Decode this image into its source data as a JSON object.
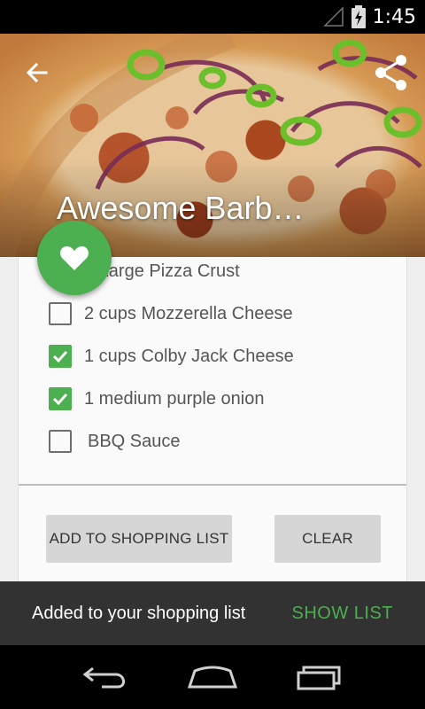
{
  "status_bar": {
    "time": "1:45"
  },
  "recipe": {
    "title": "Awesome Barb…"
  },
  "ingredients": [
    {
      "label": "1 Large Pizza Crust",
      "checked": false
    },
    {
      "label": "2 cups Mozzerella Cheese",
      "checked": false
    },
    {
      "label": "1 cups Colby Jack Cheese",
      "checked": true
    },
    {
      "label": "1 medium purple onion",
      "checked": true
    },
    {
      "label": "BBQ Sauce",
      "checked": false
    }
  ],
  "actions": {
    "add_label": "ADD TO SHOPPING LIST",
    "clear_label": "CLEAR"
  },
  "snackbar": {
    "message": "Added to your shopping list",
    "action": "SHOW LIST"
  },
  "colors": {
    "accent": "#4caf50",
    "snackbar_bg": "#323232",
    "button_bg": "#d6d6d6"
  },
  "icons": {
    "back": "arrow-back-icon",
    "share": "share-icon",
    "favorite": "heart-icon",
    "nav_back": "nav-back-icon",
    "nav_home": "nav-home-icon",
    "nav_recents": "nav-recents-icon"
  }
}
